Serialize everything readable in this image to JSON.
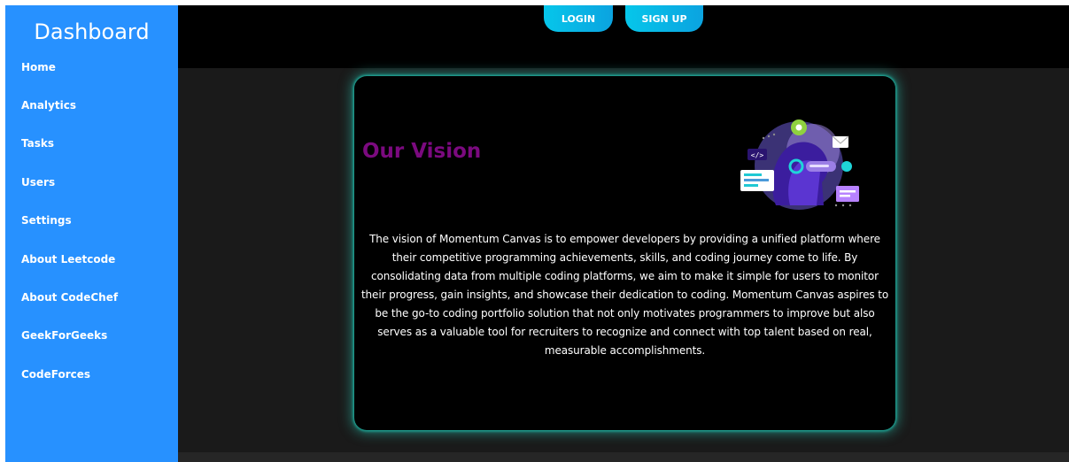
{
  "sidebar": {
    "title": "Dashboard",
    "items": [
      {
        "label": "Home"
      },
      {
        "label": "Analytics"
      },
      {
        "label": "Tasks"
      },
      {
        "label": "Users"
      },
      {
        "label": "Settings"
      },
      {
        "label": "About Leetcode"
      },
      {
        "label": "About CodeChef"
      },
      {
        "label": "GeekForGeeks"
      },
      {
        "label": "CodeForces"
      }
    ]
  },
  "header": {
    "login_label": "LOGIN",
    "signup_label": "SIGN UP"
  },
  "vision": {
    "title": "Our Vision",
    "illustration_icon": "coding-profile-illustration",
    "text": "The vision of Momentum Canvas is to empower developers by providing a unified platform where their competitive programming achievements, skills, and coding journey come to life. By consolidating data from multiple coding platforms, we aim to make it simple for users to monitor their progress, gain insights, and showcase their dedication to coding. Momentum Canvas aspires to be the go-to coding portfolio solution that not only motivates programmers to improve but also serves as a valuable tool for recruiters to recognize and connect with top talent based on real, measurable accomplishments."
  },
  "colors": {
    "sidebar_bg": "#2791ff",
    "button_gradient_start": "#06c6ea",
    "title_purple": "#7b0a7f",
    "card_glow": "#1ab8a8"
  }
}
